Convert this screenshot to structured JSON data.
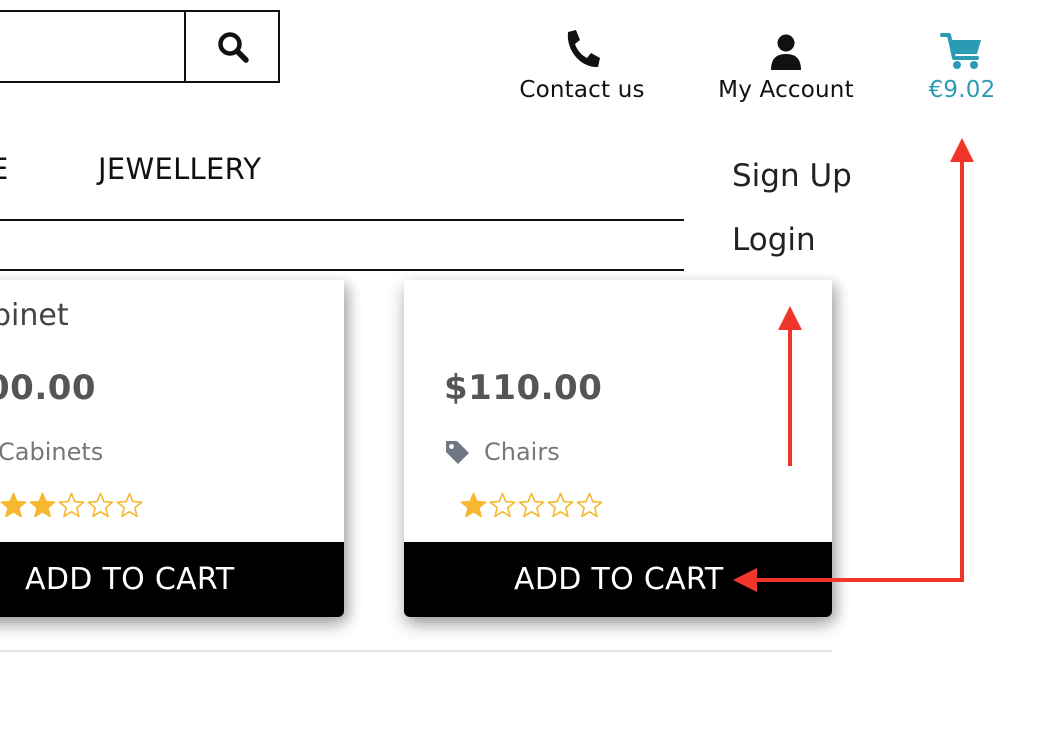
{
  "search": {
    "value": "",
    "placeholder": ""
  },
  "header": {
    "contact_label": "Contact us",
    "account_label": "My Account",
    "cart_total": "€9.02"
  },
  "nav": {
    "items": [
      "E",
      "JEWELLERY"
    ]
  },
  "account_dropdown": {
    "items": [
      "Sign Up",
      "Login"
    ]
  },
  "products": [
    {
      "name": "pinet",
      "price": "00.00",
      "category": "Cabinets",
      "rating": 2,
      "cta": "ADD TO CART"
    },
    {
      "name": "",
      "price": "$110.00",
      "category": "Chairs",
      "rating": 1,
      "cta": "ADD TO CART"
    }
  ],
  "colors": {
    "accent": "#2a9bb3",
    "star": "#f5b82e",
    "annotation": "#f0362a",
    "button_bg": "#000000"
  },
  "icons": [
    "search-icon",
    "phone-icon",
    "user-icon",
    "cart-icon",
    "tag-icon",
    "star-icon"
  ]
}
